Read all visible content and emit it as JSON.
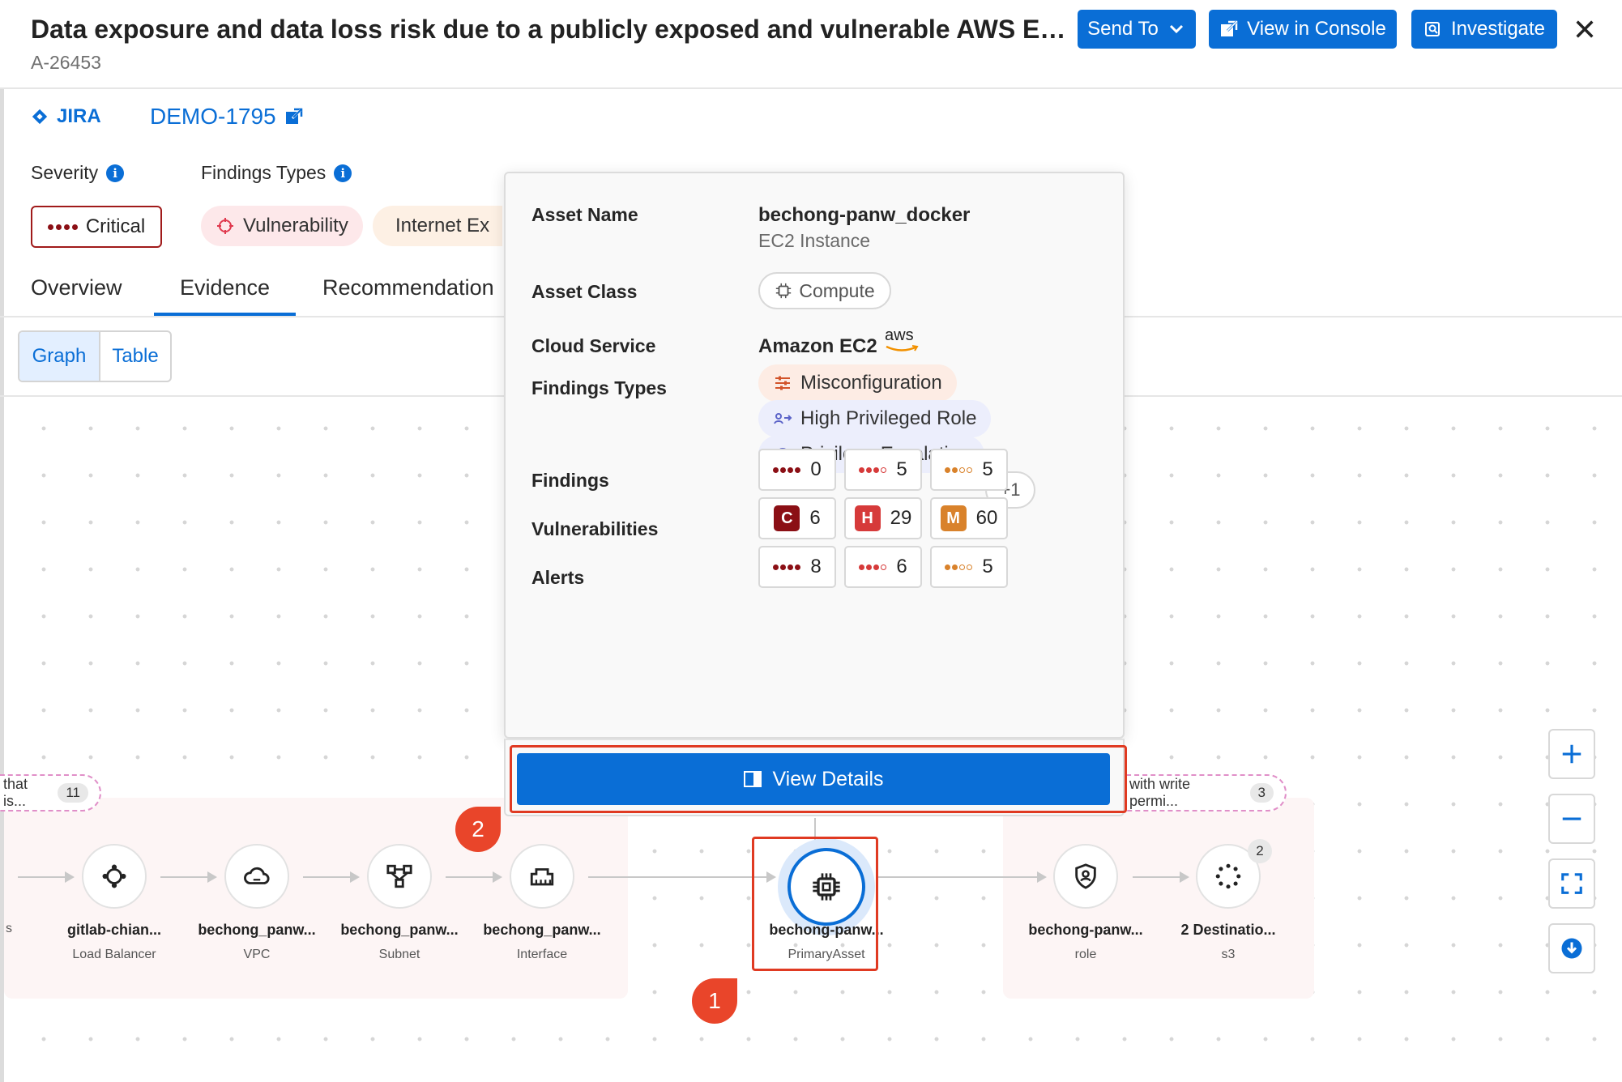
{
  "header": {
    "title": "Data exposure and data loss risk due to a publicly exposed and vulnerable AWS EC2 inst...",
    "alert_id": "A-26453",
    "send_to": "Send To",
    "view_console": "View in Console",
    "investigate": "Investigate"
  },
  "ticket": {
    "system": "JIRA",
    "id": "DEMO-1795"
  },
  "severity": {
    "label": "Severity",
    "value": "Critical"
  },
  "findings_types": {
    "label": "Findings Types",
    "items": [
      "Vulnerability",
      "Internet Ex"
    ]
  },
  "tabs": [
    "Overview",
    "Evidence",
    "Recommendation"
  ],
  "view_toggle": [
    "Graph",
    "Table"
  ],
  "graph": {
    "left_group": {
      "label": "that is...",
      "count": "11"
    },
    "right_group": {
      "label": "with write permi...",
      "count": "3"
    },
    "nodes": [
      {
        "name": "gitlab-chian...",
        "type": "Load Balancer"
      },
      {
        "name": "bechong_panw...",
        "type": "VPC"
      },
      {
        "name": "bechong_panw...",
        "type": "Subnet"
      },
      {
        "name": "bechong_panw...",
        "type": "Interface"
      },
      {
        "name": "bechong-panw...",
        "type": "PrimaryAsset"
      },
      {
        "name": "bechong-panw...",
        "type": "role"
      },
      {
        "name": "2 Destinatio...",
        "type": "s3",
        "badge": "2"
      }
    ],
    "left_edge_fragment": "s"
  },
  "callouts": [
    "1",
    "2"
  ],
  "popover": {
    "asset_name_label": "Asset Name",
    "asset_name": "bechong-panw_docker",
    "asset_kind": "EC2 Instance",
    "asset_class_label": "Asset Class",
    "asset_class": "Compute",
    "cloud_service_label": "Cloud Service",
    "cloud_service": "Amazon EC2",
    "cloud_logo": "aws",
    "findings_types_label": "Findings Types",
    "findings_types": [
      "Misconfiguration",
      "High Privileged Role",
      "Privilege Escalation"
    ],
    "findings_types_more": "+1",
    "findings_label": "Findings",
    "findings": [
      "0",
      "5",
      "5"
    ],
    "vulnerabilities_label": "Vulnerabilities",
    "vulnerabilities": [
      {
        "letter": "C",
        "count": "6"
      },
      {
        "letter": "H",
        "count": "29"
      },
      {
        "letter": "M",
        "count": "60"
      }
    ],
    "alerts_label": "Alerts",
    "alerts": [
      "8",
      "6",
      "5"
    ],
    "view_details": "View Details"
  },
  "colors": {
    "accent": "#0a6ed6",
    "critical": "#8b0f15",
    "high": "#d63a3a",
    "medium": "#d9822b",
    "callout": "#e9452a"
  }
}
